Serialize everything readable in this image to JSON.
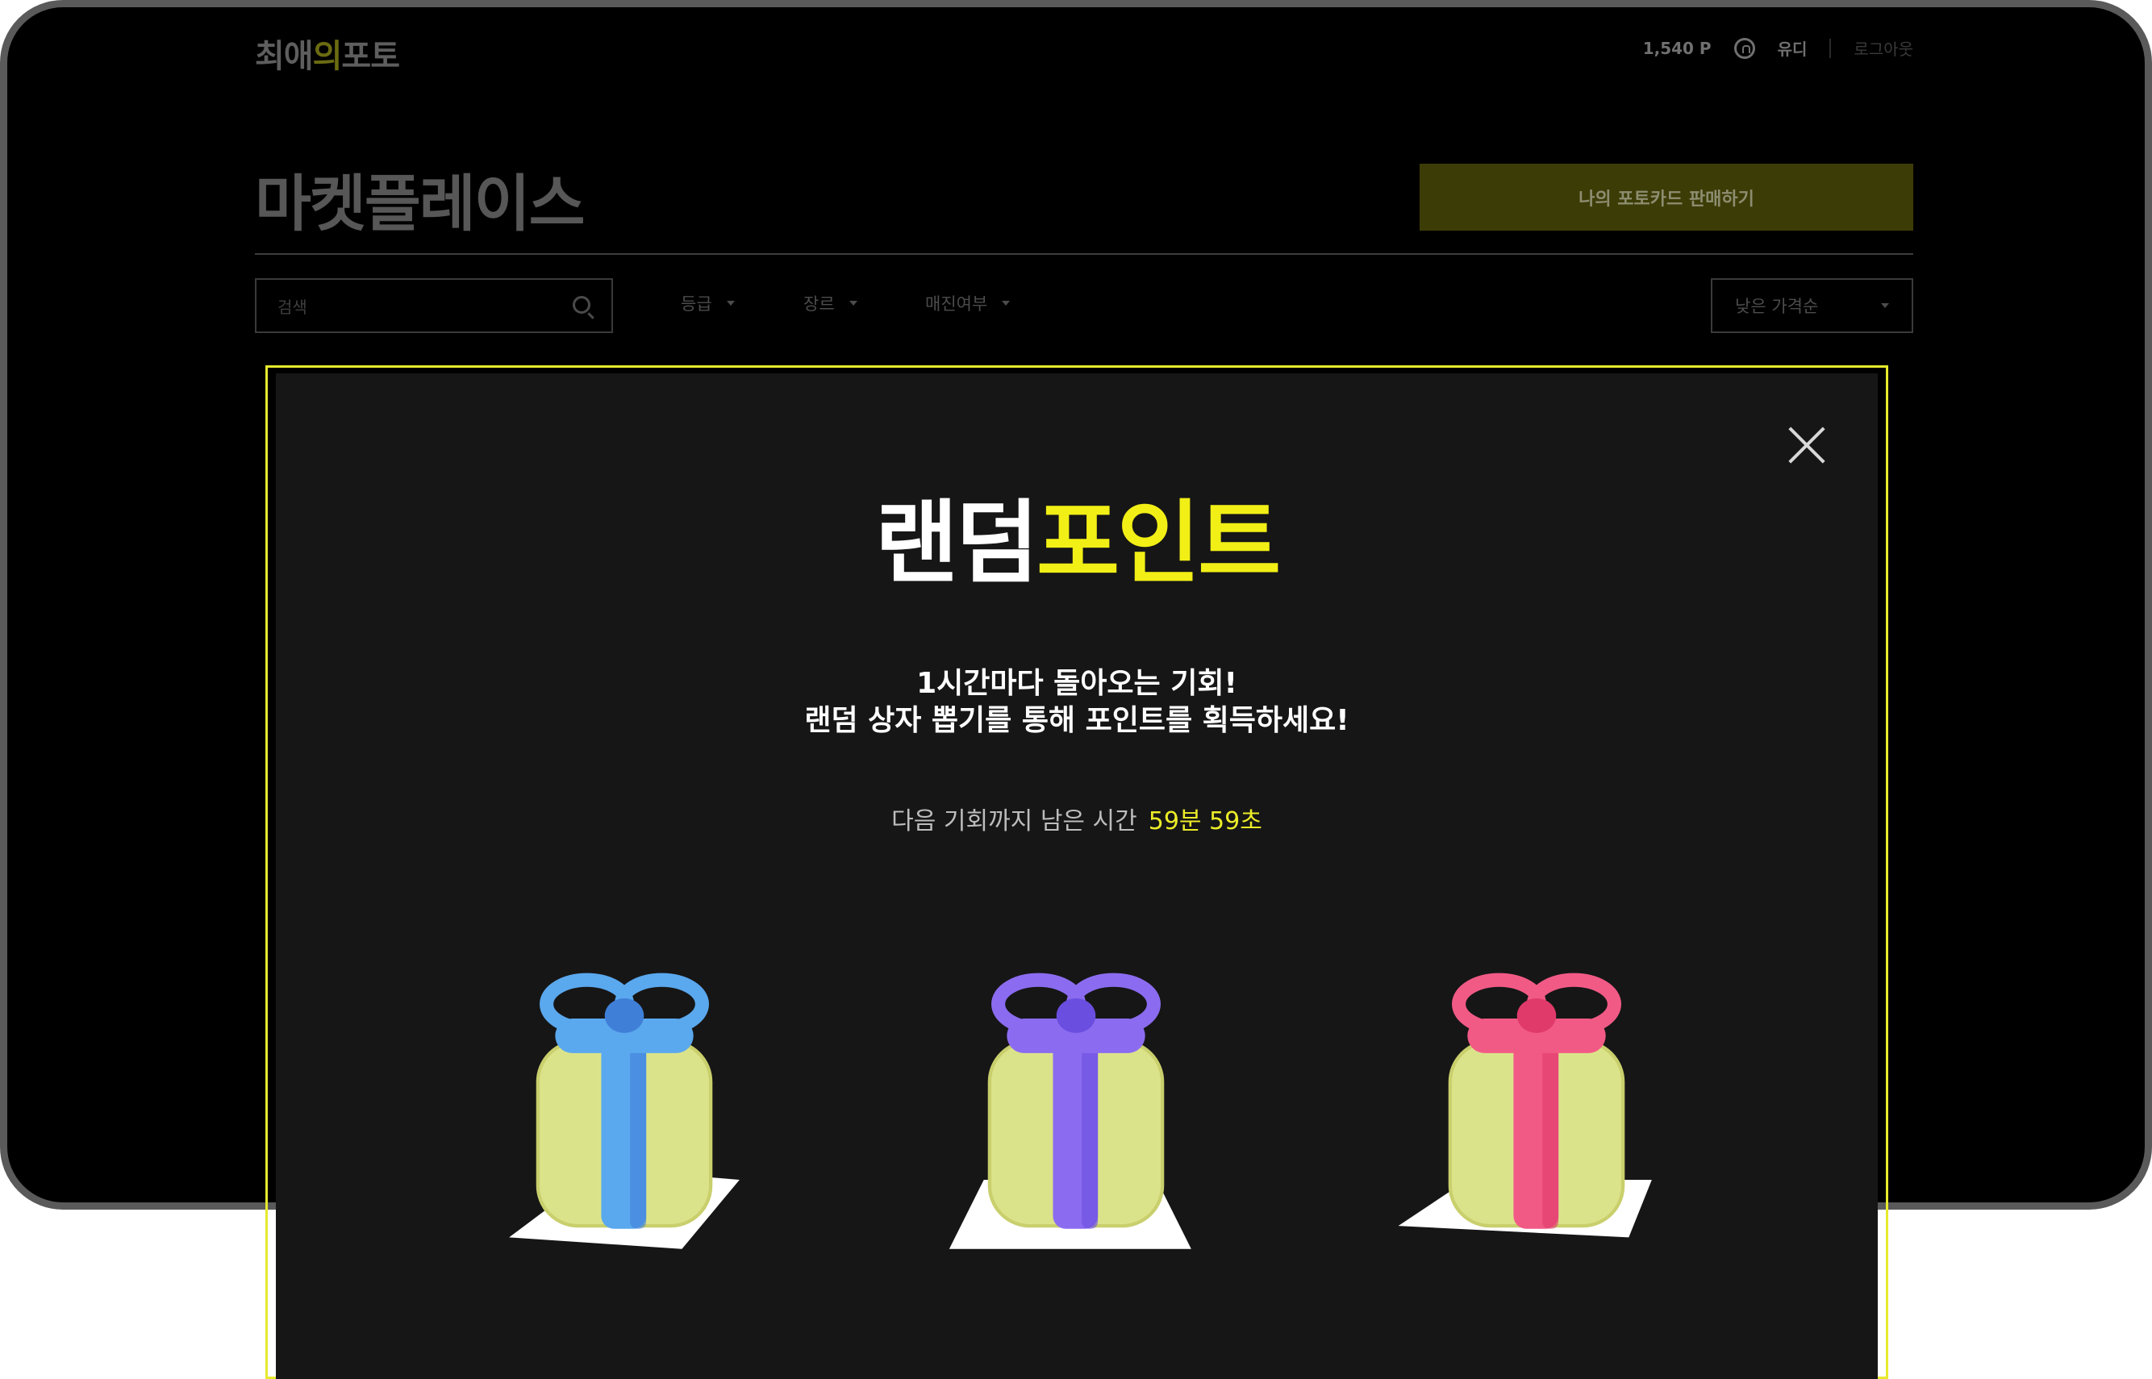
{
  "gnb": {
    "logo_prefix": "최애",
    "logo_accent": "의",
    "logo_suffix": "포토",
    "points": "1,540 P",
    "user_name": "유디",
    "logout": "로그아웃"
  },
  "page": {
    "title": "마켓플레이스",
    "sell_button": "나의 포토카드 판매하기",
    "search_placeholder": "검색",
    "filters": [
      "등급",
      "장르",
      "매진여부"
    ],
    "sort": "낮은 가격순"
  },
  "modal": {
    "title_white": "랜덤",
    "title_yellow": "포인트",
    "desc_line1": "1시간마다 돌아오는 기회!",
    "desc_line2": "랜덤 상자 뽑기를 통해 포인트를 획득하세요!",
    "timer_label": "다음 기회까지 남은 시간",
    "timer_value": "59분 59초",
    "boxes": [
      {
        "ribbon": "#5aa8ee",
        "ribbon_dark": "#3f7fd8"
      },
      {
        "ribbon": "#8b6cf0",
        "ribbon_dark": "#6a4ee0"
      },
      {
        "ribbon": "#f25a86",
        "ribbon_dark": "#e03a6a"
      }
    ]
  },
  "colors": {
    "accent": "#f2ef16",
    "modal_bg": "#161616",
    "box_body": "#dbe38a"
  }
}
